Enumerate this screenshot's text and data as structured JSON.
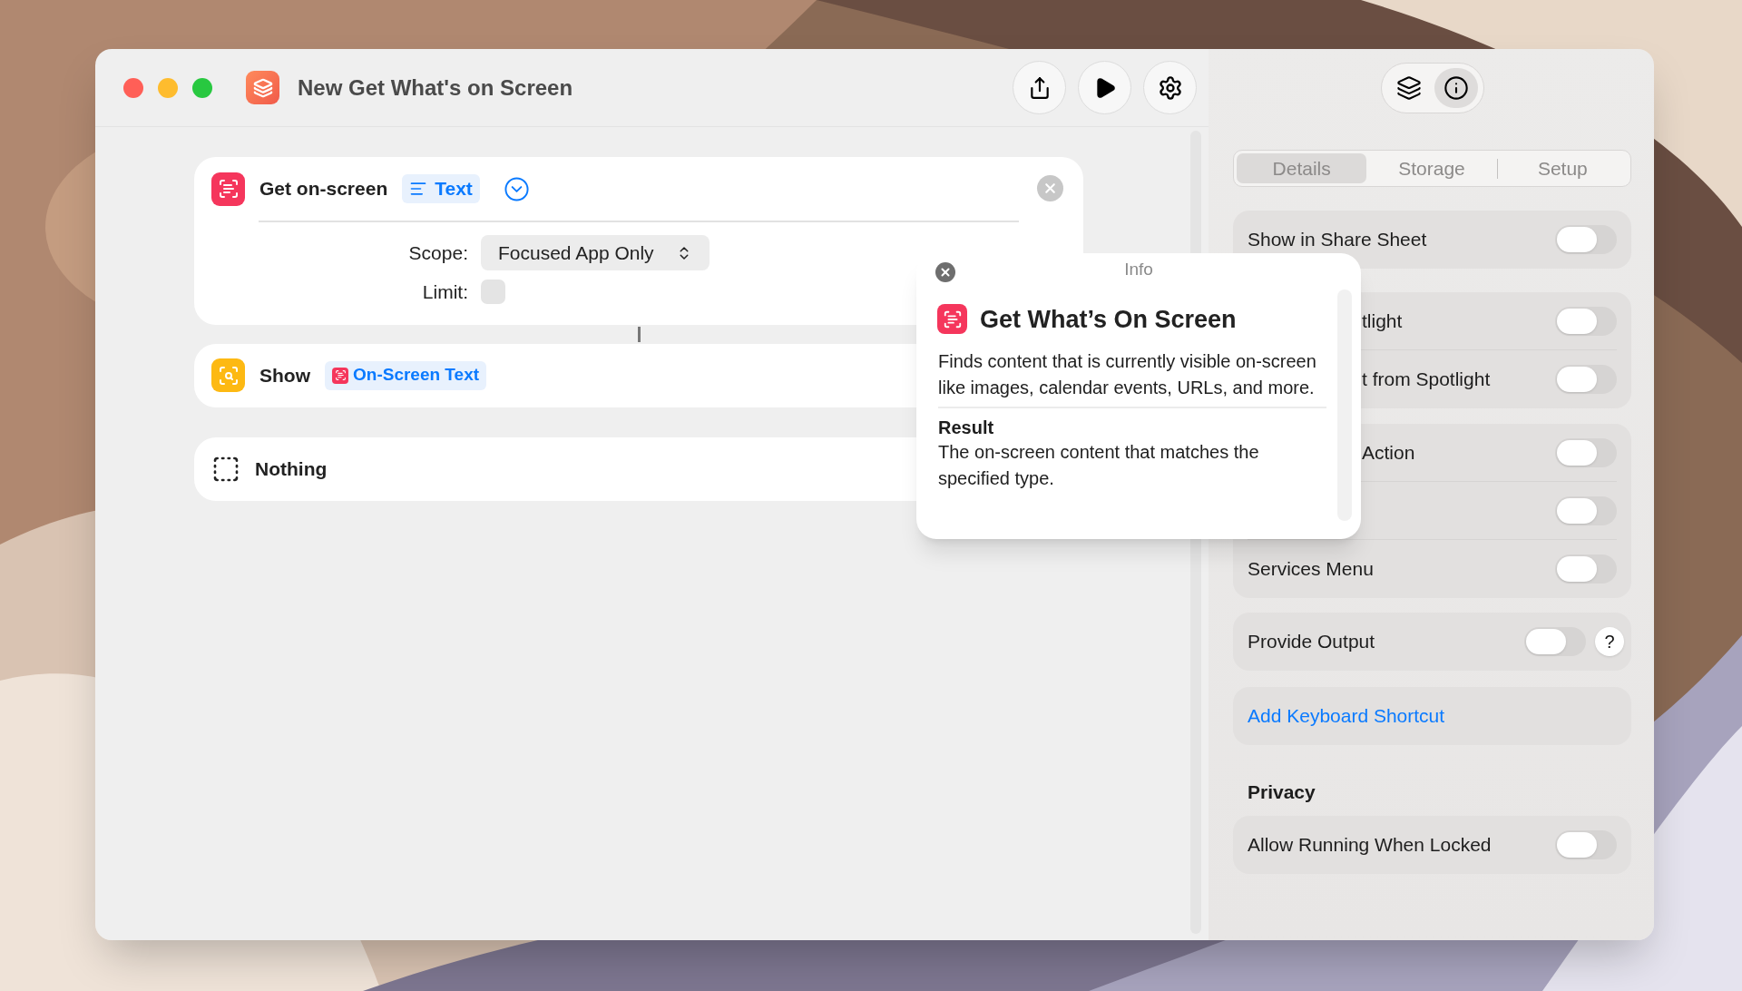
{
  "window": {
    "title": "New Get What's on Screen"
  },
  "actions": [
    {
      "kind": "get",
      "label": "Get on-screen",
      "token": "Text",
      "params": [
        {
          "kind": "popup",
          "label": "Scope:",
          "value": "Focused App Only"
        },
        {
          "kind": "checkbox",
          "label": "Limit:",
          "checked": false
        }
      ]
    },
    {
      "kind": "show",
      "label": "Show",
      "token": "On-Screen Text"
    },
    {
      "kind": "nothing",
      "label": "Nothing"
    }
  ],
  "info_popover": {
    "header": "Info",
    "title": "Get What’s On Screen",
    "description": "Finds content that is currently visible on-screen like images, calendar events, URLs, and more.",
    "result_heading": "Result",
    "result": "The on-screen content that matches the specified type."
  },
  "inspector": {
    "toolbar": [
      {
        "kind": "library",
        "selected": false
      },
      {
        "kind": "info",
        "selected": true
      }
    ],
    "tabs": [
      {
        "label": "Details",
        "selected": true
      },
      {
        "label": "Storage",
        "selected": false
      },
      {
        "label": "Setup",
        "selected": false
      }
    ],
    "groups": [
      {
        "rows": [
          {
            "label": "Show in Share Sheet",
            "on": false
          }
        ]
      },
      {
        "rows": [
          {
            "label": "tlight",
            "on": false,
            "partly_hidden": true
          },
          {
            "label": "t from Spotlight",
            "on": false,
            "partly_hidden": true
          }
        ]
      },
      {
        "rows": [
          {
            "label": "Action",
            "on": false,
            "partly_hidden": true
          },
          {
            "on": false,
            "partly_hidden": true
          },
          {
            "label": "Services Menu",
            "on": false
          }
        ]
      },
      {
        "rows": [
          {
            "label": "Provide Output",
            "on": false,
            "help": "?"
          }
        ]
      }
    ],
    "link": "Add Keyboard Shortcut",
    "privacy": {
      "heading": "Privacy",
      "rows": [
        {
          "label": "Allow Running When Locked",
          "on": false
        }
      ]
    }
  }
}
